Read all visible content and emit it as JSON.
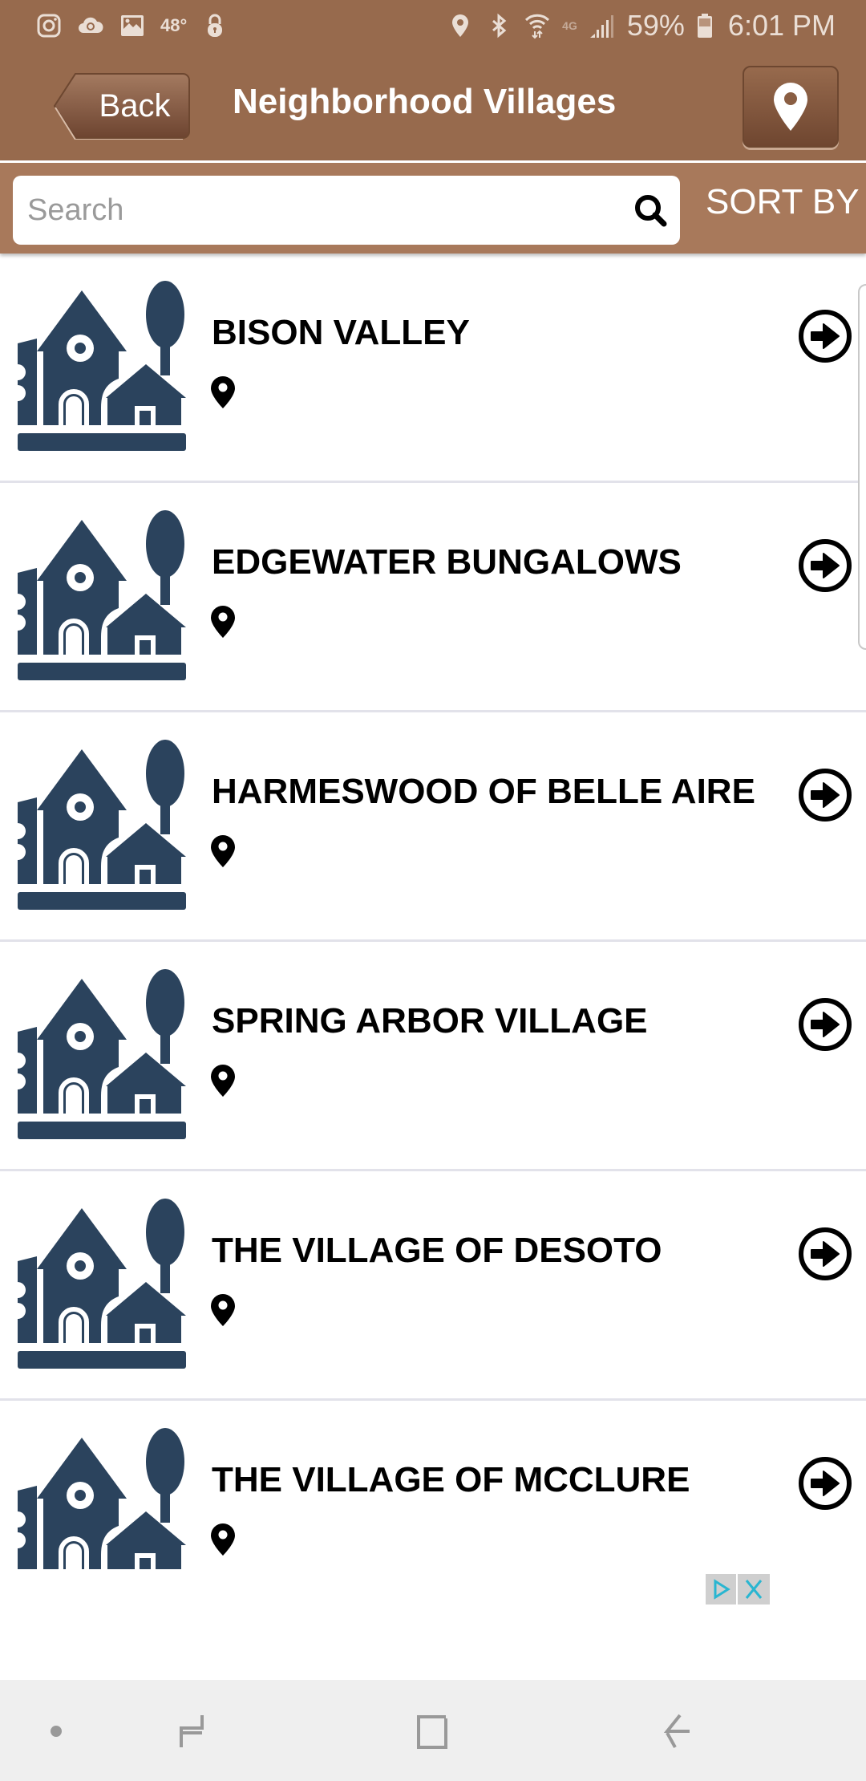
{
  "status_bar": {
    "left_icons": [
      "instagram-icon",
      "cloud-sync-icon",
      "gallery-icon"
    ],
    "temperature": "48°",
    "right_icons": [
      "location-icon",
      "bluetooth-icon",
      "wifi-icon",
      "lte-icon",
      "signal-icon"
    ],
    "network_label": "4G",
    "battery_percent": "59%",
    "time": "6:01 PM"
  },
  "header": {
    "back_label": "Back",
    "title": "Neighborhood Villages",
    "map_button_icon": "map-pin-icon"
  },
  "search": {
    "placeholder": "Search",
    "value": "",
    "sort_label": "SORT BY"
  },
  "villages": [
    {
      "name": "BISON VALLEY"
    },
    {
      "name": "EDGEWATER BUNGALOWS"
    },
    {
      "name": "HARMESWOOD OF BELLE AIRE"
    },
    {
      "name": "SPRING ARBOR VILLAGE"
    },
    {
      "name": "THE VILLAGE OF DESOTO"
    },
    {
      "name": "THE VILLAGE OF MCCLURE"
    }
  ],
  "colors": {
    "header_brown": "#976a4d",
    "searchbar_brown": "#a8795b",
    "icon_navy": "#2b435d",
    "separator": "#e2e2ea",
    "ad_accent": "#29b6d1"
  }
}
